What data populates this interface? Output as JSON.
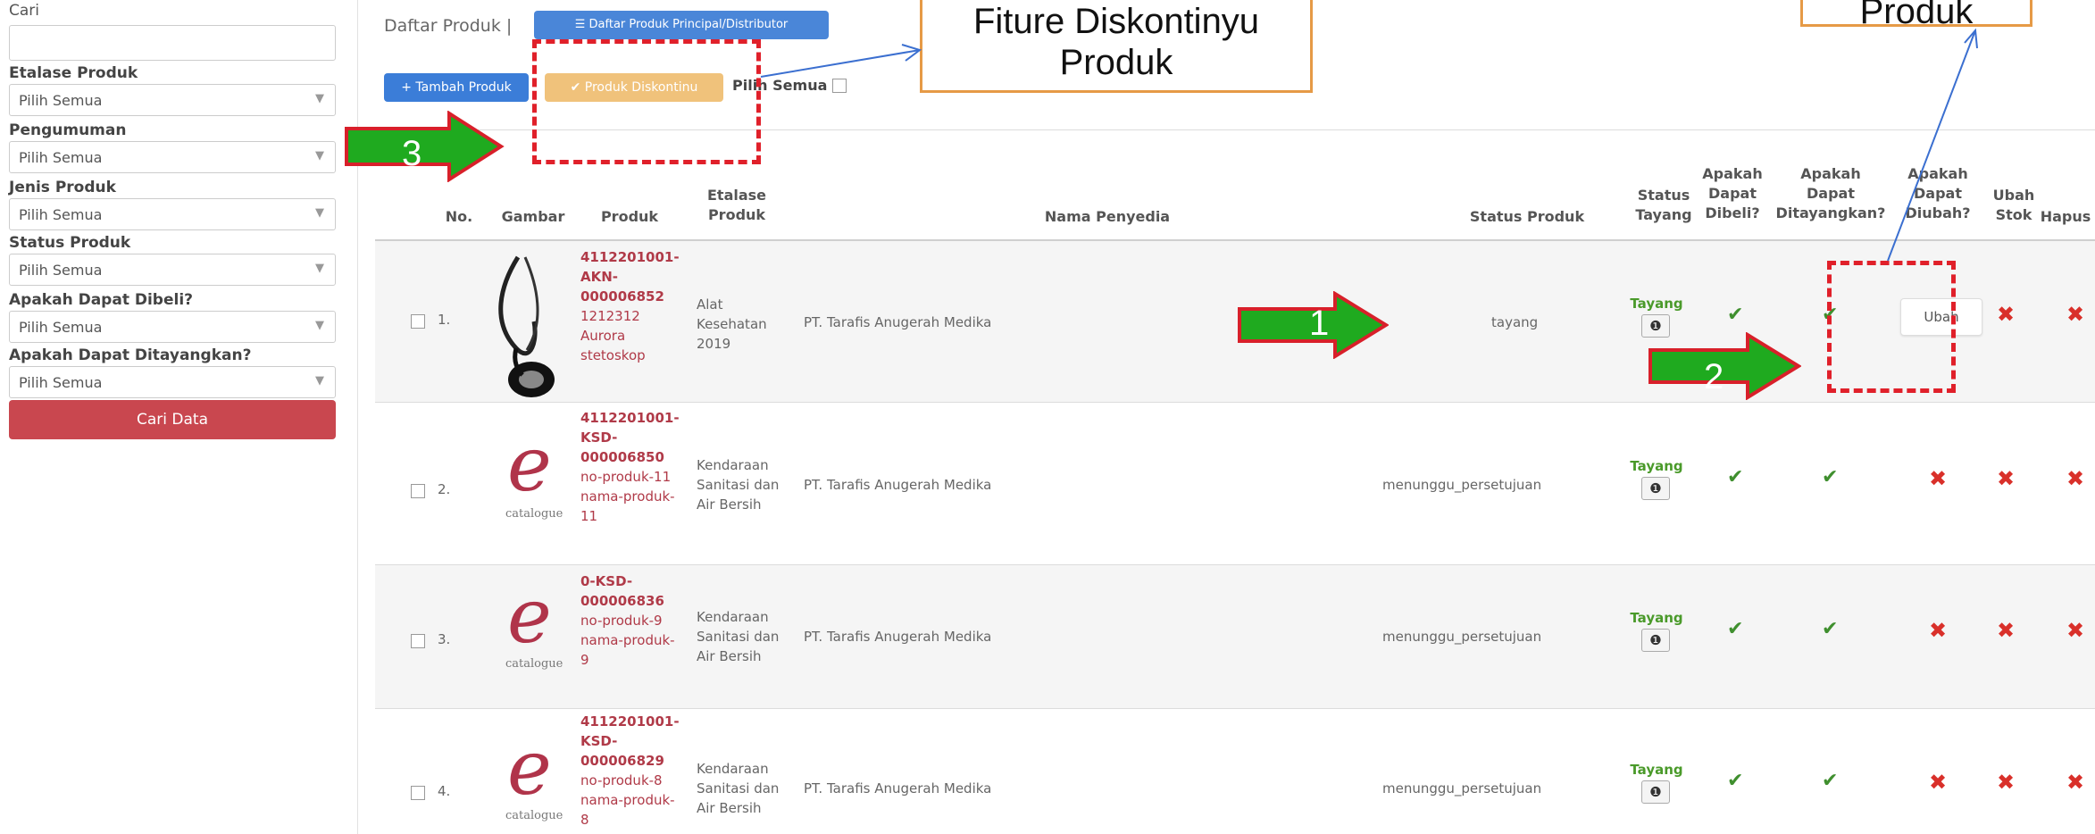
{
  "filters": {
    "search_label": "Cari",
    "search_value": "",
    "fields": [
      {
        "label": "Etalase Produk",
        "value": "Pilih Semua"
      },
      {
        "label": "Pengumuman",
        "value": "Pilih Semua"
      },
      {
        "label": "Jenis Produk",
        "value": "Pilih Semua"
      },
      {
        "label": "Status Produk",
        "value": "Pilih Semua"
      },
      {
        "label": "Apakah Dapat Dibeli?",
        "value": "Pilih Semua"
      },
      {
        "label": "Apakah Dapat Ditayangkan?",
        "value": "Pilih Semua"
      }
    ],
    "submit_label": "Cari Data"
  },
  "header": {
    "title": "Daftar Produk |",
    "principal_button": "Daftar Produk Principal/Distributor",
    "add_button": "+ Tambah Produk",
    "discontinue_button": "✔ Produk Diskontinu",
    "select_all_label": "Pilih Semua"
  },
  "table": {
    "columns": {
      "no": "No.",
      "gambar": "Gambar",
      "produk": "Produk",
      "etalase": [
        "Etalase",
        "Produk"
      ],
      "penyedia": "Nama Penyedia",
      "status_produk": "Status Produk",
      "status_tayang": [
        "Status",
        "Tayang"
      ],
      "dibeli": [
        "Apakah",
        "Dapat",
        "Dibeli?"
      ],
      "ditayangkan": [
        "Apakah",
        "Dapat",
        "Ditayangkan?"
      ],
      "diubah": [
        "Apakah",
        "Dapat",
        "Diubah?"
      ],
      "ubah_stok": [
        "Ubah",
        "Stok"
      ],
      "hapus": "Hapus"
    },
    "rows": [
      {
        "no": "1.",
        "code": [
          "4112201001-",
          "AKN-",
          "000006852"
        ],
        "name": [
          "1212312",
          "Aurora",
          "stetoskop"
        ],
        "etalase": [
          "Alat",
          "Kesehatan",
          "2019"
        ],
        "penyedia": "PT. Tarafis Anugerah Medika",
        "status": "tayang",
        "tayang": "Tayang",
        "ubah": "Ubah"
      },
      {
        "no": "2.",
        "code": [
          "4112201001-",
          "KSD-",
          "000006850"
        ],
        "name": [
          "no-produk-11",
          "nama-produk-",
          "11"
        ],
        "etalase": [
          "Kendaraan",
          "Sanitasi dan",
          "Air Bersih"
        ],
        "penyedia": "PT. Tarafis Anugerah Medika",
        "status": "menunggu_persetujuan",
        "tayang": "Tayang",
        "logo": "catalogue"
      },
      {
        "no": "3.",
        "code": [
          "0-KSD-",
          "000006836"
        ],
        "name": [
          "no-produk-9",
          "nama-produk-",
          "9"
        ],
        "etalase": [
          "Kendaraan",
          "Sanitasi dan",
          "Air Bersih"
        ],
        "penyedia": "PT. Tarafis Anugerah Medika",
        "status": "menunggu_persetujuan",
        "tayang": "Tayang",
        "logo": "catalogue"
      },
      {
        "no": "4.",
        "code": [
          "4112201001-",
          "KSD-",
          "000006829"
        ],
        "name": [
          "no-produk-8",
          "nama-produk-",
          "8"
        ],
        "etalase": [
          "Kendaraan",
          "Sanitasi dan",
          "Air Bersih"
        ],
        "penyedia": "PT. Tarafis Anugerah Medika",
        "status": "menunggu_persetujuan",
        "tayang": "Tayang",
        "logo": "catalogue"
      }
    ]
  },
  "annotations": {
    "callout_discontinue": [
      "Fiture Diskontinyu",
      "Produk"
    ],
    "callout_right": "Produk",
    "arrow_labels": [
      "1",
      "2",
      "3"
    ]
  },
  "icons": {
    "info": "info-icon",
    "check": "check-icon",
    "cross": "cross-icon"
  },
  "colors": {
    "danger": "#c9474f",
    "primary": "#3b7dd8",
    "warning": "#f0c27b",
    "success": "#3f8f2e",
    "annotation": "#e0202a",
    "callout_border": "#e69a46",
    "arrow": "#1faa1f"
  }
}
